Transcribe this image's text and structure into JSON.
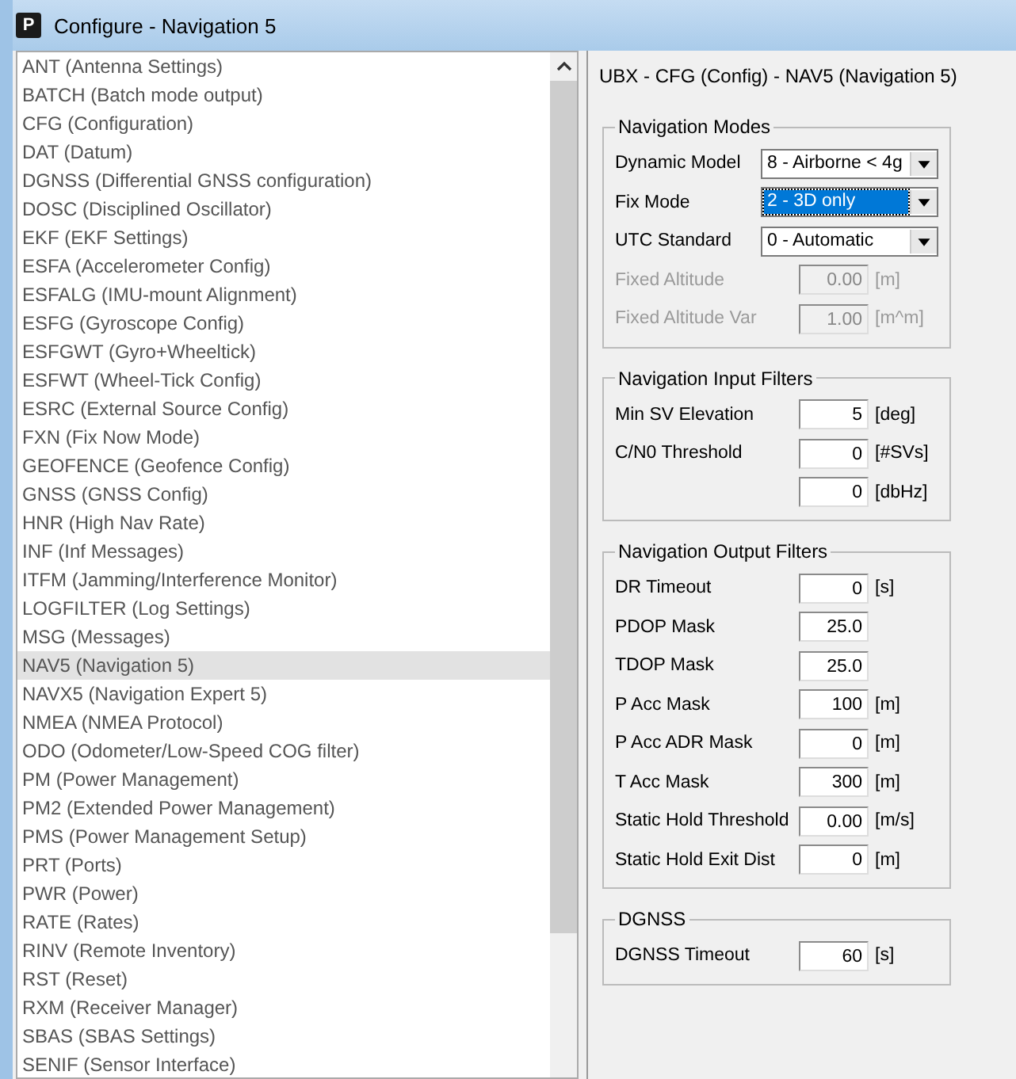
{
  "window": {
    "title": "Configure - Navigation 5",
    "icon_letter": "P"
  },
  "message_list": {
    "items": [
      {
        "label": "ANT (Antenna Settings)",
        "selected": false
      },
      {
        "label": "BATCH (Batch mode output)",
        "selected": false
      },
      {
        "label": "CFG (Configuration)",
        "selected": false
      },
      {
        "label": "DAT (Datum)",
        "selected": false
      },
      {
        "label": "DGNSS (Differential GNSS configuration)",
        "selected": false
      },
      {
        "label": "DOSC (Disciplined Oscillator)",
        "selected": false
      },
      {
        "label": "EKF (EKF Settings)",
        "selected": false
      },
      {
        "label": "ESFA (Accelerometer Config)",
        "selected": false
      },
      {
        "label": "ESFALG (IMU-mount Alignment)",
        "selected": false
      },
      {
        "label": "ESFG (Gyroscope Config)",
        "selected": false
      },
      {
        "label": "ESFGWT (Gyro+Wheeltick)",
        "selected": false
      },
      {
        "label": "ESFWT (Wheel-Tick Config)",
        "selected": false
      },
      {
        "label": "ESRC (External Source Config)",
        "selected": false
      },
      {
        "label": "FXN (Fix Now Mode)",
        "selected": false
      },
      {
        "label": "GEOFENCE (Geofence Config)",
        "selected": false
      },
      {
        "label": "GNSS (GNSS Config)",
        "selected": false
      },
      {
        "label": "HNR (High Nav Rate)",
        "selected": false
      },
      {
        "label": "INF (Inf Messages)",
        "selected": false
      },
      {
        "label": "ITFM (Jamming/Interference Monitor)",
        "selected": false
      },
      {
        "label": "LOGFILTER (Log Settings)",
        "selected": false
      },
      {
        "label": "MSG (Messages)",
        "selected": false
      },
      {
        "label": "NAV5 (Navigation 5)",
        "selected": true
      },
      {
        "label": "NAVX5 (Navigation Expert 5)",
        "selected": false
      },
      {
        "label": "NMEA (NMEA Protocol)",
        "selected": false
      },
      {
        "label": "ODO (Odometer/Low-Speed COG filter)",
        "selected": false
      },
      {
        "label": "PM (Power Management)",
        "selected": false
      },
      {
        "label": "PM2 (Extended Power Management)",
        "selected": false
      },
      {
        "label": "PMS (Power Management Setup)",
        "selected": false
      },
      {
        "label": "PRT (Ports)",
        "selected": false
      },
      {
        "label": "PWR (Power)",
        "selected": false
      },
      {
        "label": "RATE (Rates)",
        "selected": false
      },
      {
        "label": "RINV (Remote Inventory)",
        "selected": false
      },
      {
        "label": "RST (Reset)",
        "selected": false
      },
      {
        "label": "RXM (Receiver Manager)",
        "selected": false
      },
      {
        "label": "SBAS (SBAS Settings)",
        "selected": false
      },
      {
        "label": "SENIF (Sensor Interface)",
        "selected": false
      }
    ]
  },
  "panel": {
    "heading": "UBX - CFG (Config) - NAV5 (Navigation 5)",
    "groups": [
      {
        "title": "Navigation Modes",
        "fields": [
          {
            "kind": "select",
            "label": "Dynamic Model",
            "value": "8 - Airborne < 4g",
            "focused": false,
            "disabled": false
          },
          {
            "kind": "select",
            "label": "Fix Mode",
            "value": "2 - 3D only",
            "focused": true,
            "disabled": false
          },
          {
            "kind": "select",
            "label": "UTC Standard",
            "value": "0 - Automatic",
            "focused": false,
            "disabled": false
          },
          {
            "kind": "number",
            "label": "Fixed Altitude",
            "value": "0.00",
            "unit": "[m]",
            "disabled": true
          },
          {
            "kind": "number",
            "label": "Fixed Altitude Var",
            "value": "1.00",
            "unit": "[m^m]",
            "disabled": true
          }
        ]
      },
      {
        "title": "Navigation Input Filters",
        "fields": [
          {
            "kind": "number",
            "label": "Min SV Elevation",
            "value": "5",
            "unit": "[deg]",
            "disabled": false
          },
          {
            "kind": "number",
            "label": "C/N0 Threshold",
            "value": "0",
            "unit": "[#SVs]",
            "disabled": false
          },
          {
            "kind": "number",
            "value": "0",
            "unit": "[dbHz]",
            "disabled": false
          }
        ]
      },
      {
        "title": "Navigation Output Filters",
        "fields": [
          {
            "kind": "number",
            "label": "DR Timeout",
            "value": "0",
            "unit": "[s]",
            "disabled": false
          },
          {
            "kind": "number",
            "label": "PDOP Mask",
            "value": "25.0",
            "disabled": false
          },
          {
            "kind": "number",
            "label": "TDOP Mask",
            "value": "25.0",
            "disabled": false
          },
          {
            "kind": "number",
            "label": "P Acc Mask",
            "value": "100",
            "unit": "[m]",
            "disabled": false
          },
          {
            "kind": "number",
            "label": "P Acc ADR Mask",
            "value": "0",
            "unit": "[m]",
            "disabled": false
          },
          {
            "kind": "number",
            "label": "T Acc Mask",
            "value": "300",
            "unit": "[m]",
            "disabled": false
          },
          {
            "kind": "number",
            "label": "Static Hold Threshold",
            "value": "0.00",
            "unit": "[m/s]",
            "disabled": false
          },
          {
            "kind": "number",
            "label": "Static Hold Exit Dist",
            "value": "0",
            "unit": "[m]",
            "disabled": false
          }
        ]
      },
      {
        "title": "DGNSS",
        "fields": [
          {
            "kind": "number",
            "label": "DGNSS Timeout",
            "value": "60",
            "unit": "[s]",
            "disabled": false
          }
        ]
      }
    ]
  }
}
